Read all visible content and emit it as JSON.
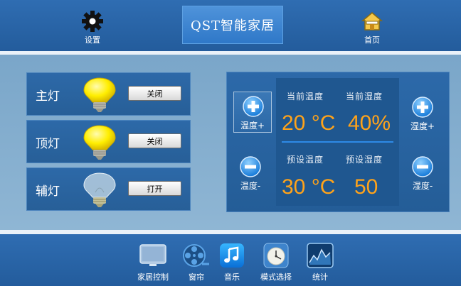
{
  "header": {
    "settings_label": "设置",
    "brand": "QST智能家居",
    "home_label": "首页"
  },
  "lights": [
    {
      "name": "主灯",
      "button": "关闭",
      "state": "on"
    },
    {
      "name": "顶灯",
      "button": "关闭",
      "state": "on"
    },
    {
      "name": "辅灯",
      "button": "打开",
      "state": "off"
    }
  ],
  "climate": {
    "current_temp_label": "当前温度",
    "current_humidity_label": "当前湿度",
    "current_temp": "20 °C",
    "current_humidity": "40%",
    "preset_temp_label": "预设温度",
    "preset_humidity_label": "预设湿度",
    "preset_temp": "30 °C",
    "preset_humidity": "50",
    "temp_up": "温度+",
    "temp_down": "温度-",
    "humidity_up": "湿度+",
    "humidity_down": "湿度-"
  },
  "dock": [
    {
      "label": "家居控制",
      "icon": "monitor-icon"
    },
    {
      "label": "窗帘",
      "icon": "film-reel-icon"
    },
    {
      "label": "音乐",
      "icon": "music-note-icon"
    },
    {
      "label": "模式选择",
      "icon": "clock-icon"
    },
    {
      "label": "统计",
      "icon": "chart-icon"
    }
  ],
  "colors": {
    "accent_value": "#ffa31a",
    "bar_blue": "#2f6db2",
    "bulb_on": "#ffee00"
  }
}
